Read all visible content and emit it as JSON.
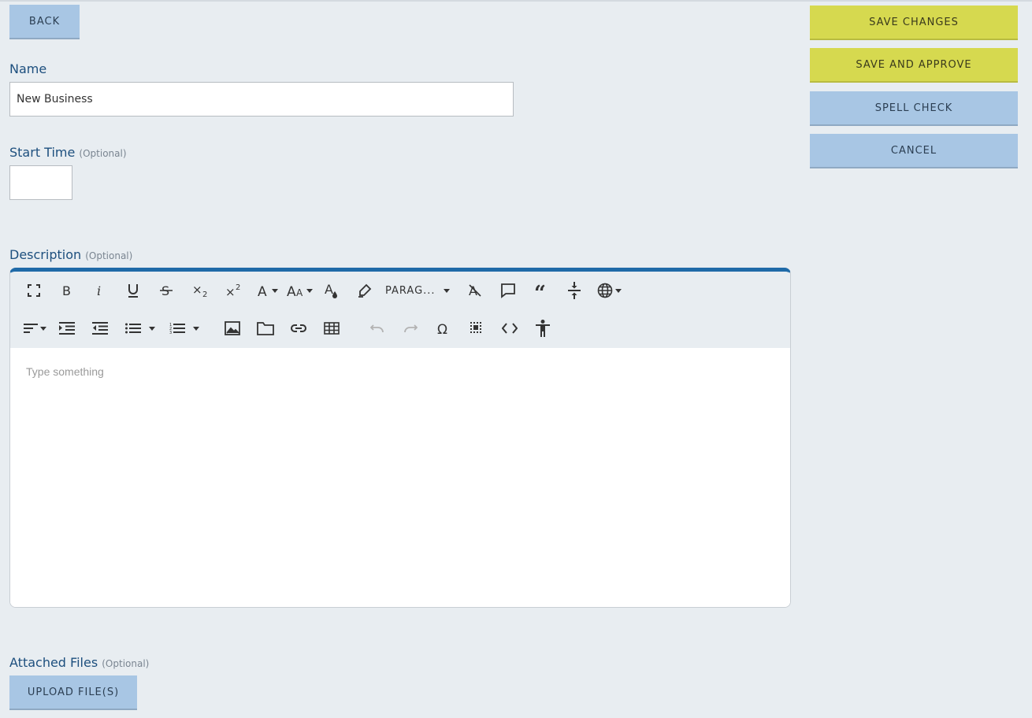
{
  "buttons": {
    "back": "BACK",
    "save_changes": "SAVE CHANGES",
    "save_and_approve": "SAVE AND APPROVE",
    "spell_check": "SPELL CHECK",
    "cancel": "CANCEL",
    "upload": "UPLOAD FILE(S)"
  },
  "colors": {
    "accent_blue": "#a8c6e4",
    "accent_yellow": "#d6d94f",
    "label_blue": "#1d4f7e",
    "editor_top_border": "#1f6aa8"
  },
  "form": {
    "name_label": "Name",
    "name_value": "New Business",
    "start_time_label": "Start Time",
    "start_time_value": "",
    "optional": "(Optional)",
    "description_label": "Description",
    "attached_files_label": "Attached Files"
  },
  "editor": {
    "paragraph_format": "PARAG...",
    "placeholder": "Type something",
    "toolbar_row1": [
      "fullscreen-icon",
      "bold-icon",
      "italic-icon",
      "underline-icon",
      "strikethrough-icon",
      "subscript-icon",
      "superscript-icon",
      "font-family-icon",
      "font-size-icon",
      "text-color-icon",
      "highlight-icon",
      "paragraph-format-dropdown",
      "clear-formatting-icon",
      "comment-icon",
      "quote-icon",
      "insert-hr-icon",
      "language-icon"
    ],
    "toolbar_row2": [
      "align-icon",
      "indent-icon",
      "outdent-icon",
      "unordered-list-icon",
      "ordered-list-icon",
      "insert-image-icon",
      "insert-file-icon",
      "insert-link-icon",
      "insert-table-icon",
      "undo-icon",
      "redo-icon",
      "special-characters-icon",
      "select-all-icon",
      "code-view-icon",
      "accessibility-icon"
    ]
  }
}
